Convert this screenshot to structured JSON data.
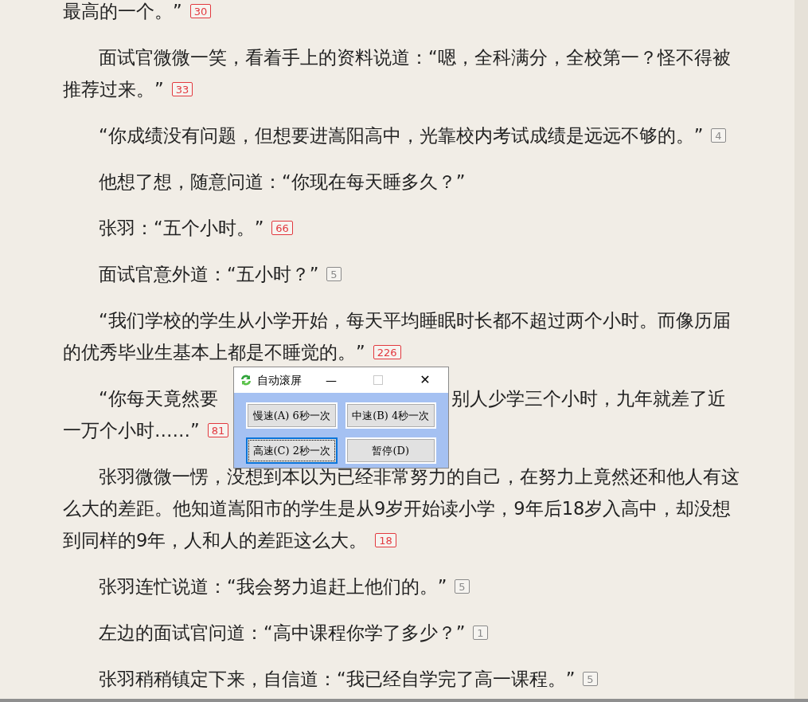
{
  "paragraphs": [
    {
      "indent": false,
      "lines": [
        [
          "最高的一个。”"
        ]
      ],
      "badge": {
        "count": "30",
        "color": "#e2393f"
      }
    },
    {
      "indent": true,
      "lines": [
        [
          "面试官微微一笑，看着手上的资料说道：“嗯，全科满分，全校第一？怪不得被"
        ],
        [
          "推荐过来。”"
        ]
      ],
      "badge": {
        "count": "33",
        "color": "#e2393f"
      }
    },
    {
      "indent": true,
      "lines": [
        [
          "“你成绩没有问题，但想要进嵩阳高中，光靠校内考试成绩是远远不够的。”"
        ]
      ],
      "badge": {
        "count": "4",
        "color": "#8a8a8a"
      }
    },
    {
      "indent": true,
      "lines": [
        [
          "他想了想，随意问道：“你现在每天睡多久？”"
        ]
      ]
    },
    {
      "indent": true,
      "lines": [
        [
          "张羽：“五个小时。”"
        ]
      ],
      "badge": {
        "count": "66",
        "color": "#e2393f"
      }
    },
    {
      "indent": true,
      "lines": [
        [
          "面试官意外道：“五小时？”"
        ]
      ],
      "badge": {
        "count": "5",
        "color": "#8a8a8a"
      }
    },
    {
      "indent": true,
      "lines": [
        [
          "“我们学校的学生从小学开始，每天平均睡眠时长都不超过两个小时。而像历届"
        ],
        [
          "的优秀毕业生基本上都是不睡觉的。”"
        ]
      ],
      "badge": {
        "count": "226",
        "color": "#e2393f"
      }
    },
    {
      "indent": true,
      "lines": [
        [
          "“你每天竟然要",
          "别人少学三个小时，九年就差了近"
        ],
        [
          "一万个小时……”"
        ]
      ],
      "badge": {
        "count": "81",
        "color": "#e2393f"
      }
    },
    {
      "indent": true,
      "lines": [
        [
          "张羽微微一愣，没想到本以为已经非常努力的自己，在努力上竟然还和他人有这"
        ],
        [
          "么大的差距。他知道嵩阳市的学生是从9岁开始读小学，9年后18岁入高中，却没想"
        ],
        [
          "到同样的9年，人和人的差距这么大。"
        ]
      ],
      "badge": {
        "count": "18",
        "color": "#e2393f"
      }
    },
    {
      "indent": true,
      "lines": [
        [
          "张羽连忙说道：“我会努力追赶上他们的。”"
        ]
      ],
      "badge": {
        "count": "5",
        "color": "#8a8a8a"
      }
    },
    {
      "indent": true,
      "lines": [
        [
          "左边的面试官问道：“高中课程你学了多少？”"
        ]
      ],
      "badge": {
        "count": "1",
        "color": "#8a8a8a"
      }
    },
    {
      "indent": true,
      "lines": [
        [
          "张羽稍稍镇定下来，自信道：“我已经自学完了高一课程。”"
        ]
      ],
      "badge": {
        "count": "5",
        "color": "#8a8a8a"
      }
    }
  ],
  "dialog": {
    "title": "自动滚屏",
    "minimize": "—",
    "close": "✕",
    "buttons": [
      {
        "label": "慢速(A) 6秒一次",
        "focused": false
      },
      {
        "label": "中速(B) 4秒一次",
        "focused": false
      },
      {
        "label": "高速(C) 2秒一次",
        "focused": true
      },
      {
        "label": "暂停(D)",
        "focused": false
      }
    ]
  }
}
